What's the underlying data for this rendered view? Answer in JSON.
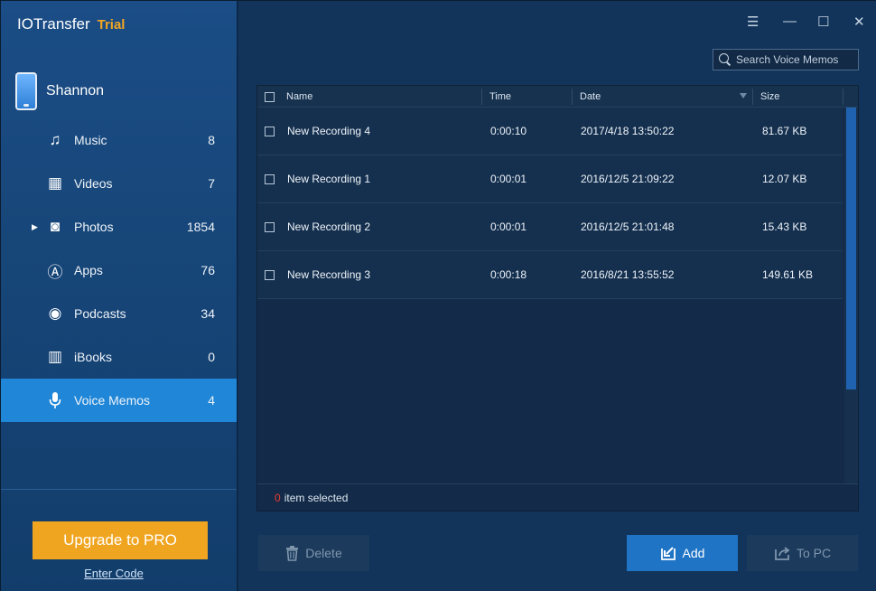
{
  "app": {
    "title": "IOTransfer",
    "edition": "Trial"
  },
  "window_controls": [
    {
      "name": "menu-icon",
      "glyph": "☰"
    },
    {
      "name": "minimize-icon",
      "glyph": "—"
    },
    {
      "name": "maximize-icon",
      "glyph": "☐"
    },
    {
      "name": "close-icon",
      "glyph": "✕"
    }
  ],
  "device": {
    "name": "Shannon"
  },
  "sidebar": {
    "items": [
      {
        "label": "Music",
        "count": "8",
        "icon": "music-icon",
        "glyph": "♫",
        "active": false,
        "expandable": false
      },
      {
        "label": "Videos",
        "count": "7",
        "icon": "film-icon",
        "glyph": "▦",
        "active": false,
        "expandable": false
      },
      {
        "label": "Photos",
        "count": "1854",
        "icon": "camera-icon",
        "glyph": "◙",
        "active": false,
        "expandable": true
      },
      {
        "label": "Apps",
        "count": "76",
        "icon": "app-store-icon",
        "glyph": "Ⓐ",
        "active": false,
        "expandable": false
      },
      {
        "label": "Podcasts",
        "count": "34",
        "icon": "podcast-icon",
        "glyph": "◉",
        "active": false,
        "expandable": false
      },
      {
        "label": "iBooks",
        "count": "0",
        "icon": "book-icon",
        "glyph": "▥",
        "active": false,
        "expandable": false
      },
      {
        "label": "Voice Memos",
        "count": "4",
        "icon": "microphone-icon",
        "glyph": "●",
        "active": true,
        "expandable": false
      }
    ],
    "expand_glyph": "▶",
    "upgrade_label": "Upgrade to PRO",
    "enter_code_label": "Enter Code"
  },
  "search": {
    "placeholder": "Search Voice Memos",
    "value": ""
  },
  "table": {
    "columns": {
      "name": "Name",
      "time": "Time",
      "date": "Date",
      "size": "Size"
    },
    "rows": [
      {
        "name": "New Recording 4",
        "time": "0:00:10",
        "date": "2017/4/18 13:50:22",
        "size": "81.67 KB"
      },
      {
        "name": "New Recording 1",
        "time": "0:00:01",
        "date": "2016/12/5 21:09:22",
        "size": "12.07 KB"
      },
      {
        "name": "New Recording 2",
        "time": "0:00:01",
        "date": "2016/12/5 21:01:48",
        "size": "15.43 KB"
      },
      {
        "name": "New Recording 3",
        "time": "0:00:18",
        "date": "2016/8/21 13:55:52",
        "size": "149.61 KB"
      }
    ]
  },
  "status": {
    "selected_count": "0",
    "selected_text": "item selected"
  },
  "actions": {
    "delete_label": "Delete",
    "add_label": "Add",
    "topc_label": "To PC"
  },
  "colors": {
    "accent": "#1f86d8",
    "upgrade": "#f0a520",
    "trial": "#f2a623",
    "selected_count": "#e83a2f"
  }
}
